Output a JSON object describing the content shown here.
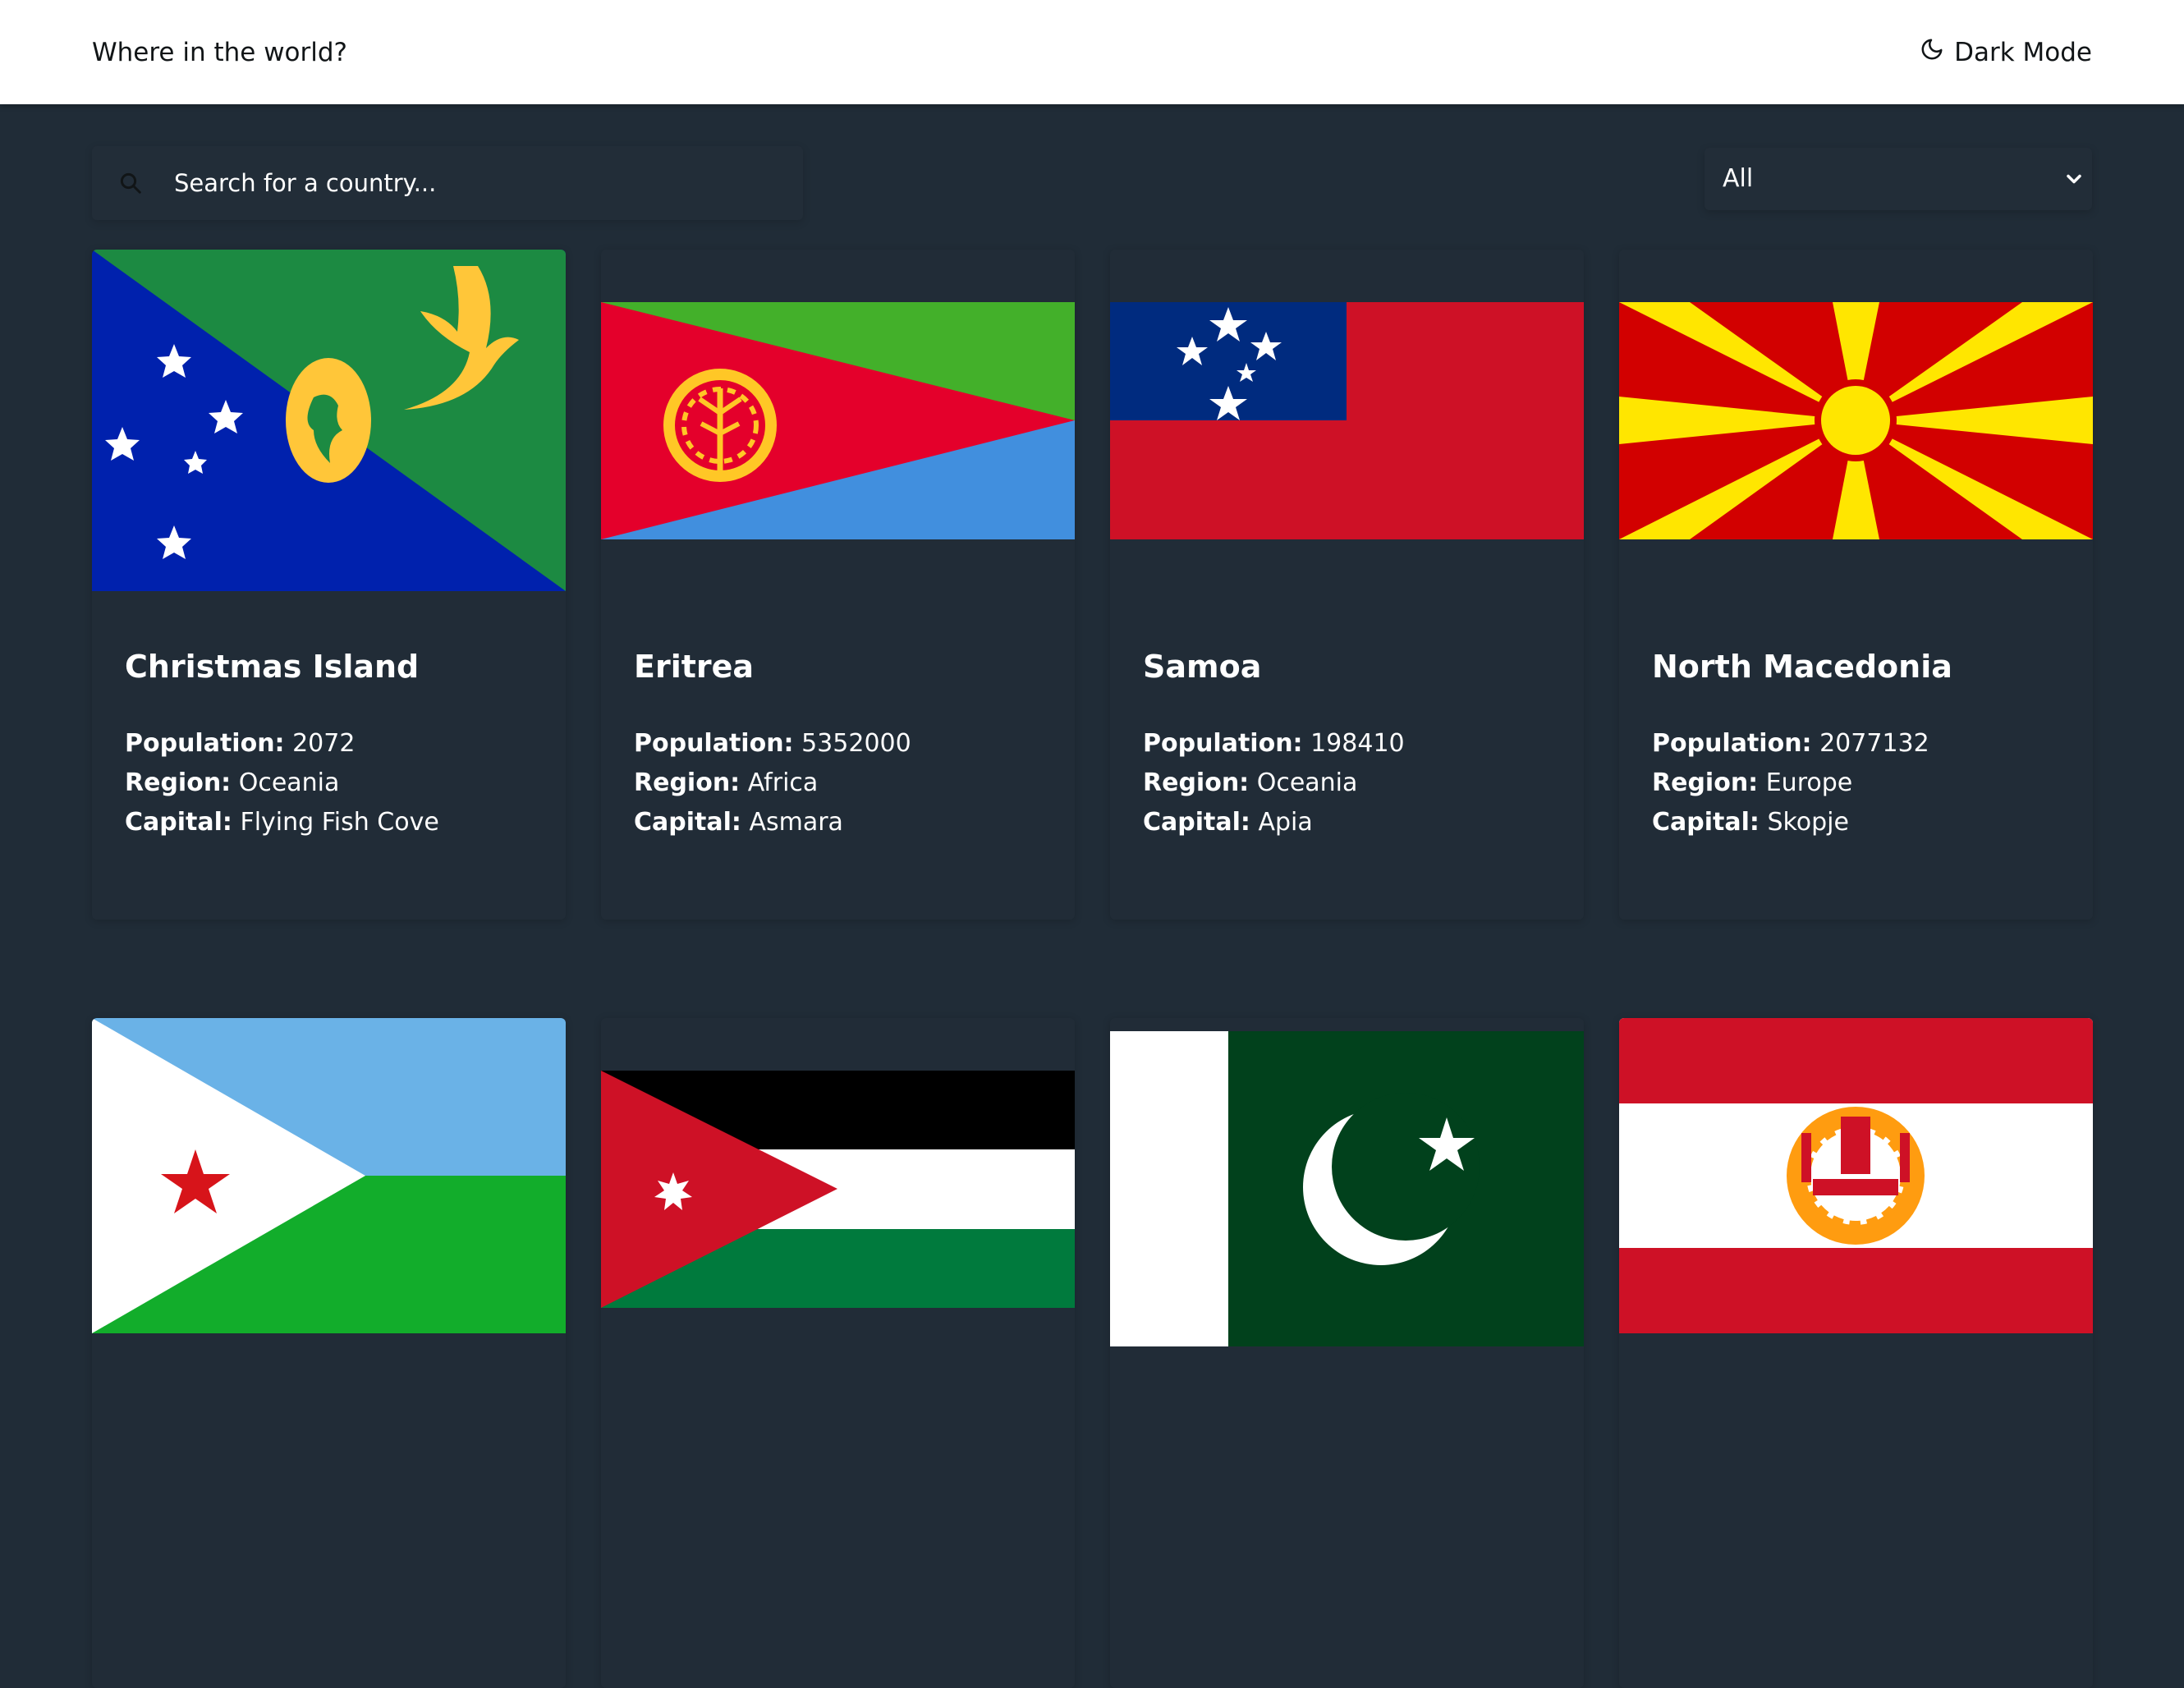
{
  "header": {
    "title": "Where in the world?",
    "mode_label": "Dark Mode"
  },
  "search": {
    "placeholder": "Search for a country..."
  },
  "filter": {
    "selected": "All"
  },
  "labels": {
    "population": "Population:",
    "region": "Region:",
    "capital": "Capital:"
  },
  "countries": [
    {
      "name": "Christmas Island",
      "population": "2072",
      "region": "Oceania",
      "capital": "Flying Fish Cove",
      "flag_icon": "christmas-island-flag"
    },
    {
      "name": "Eritrea",
      "population": "5352000",
      "region": "Africa",
      "capital": "Asmara",
      "flag_icon": "eritrea-flag"
    },
    {
      "name": "Samoa",
      "population": "198410",
      "region": "Oceania",
      "capital": "Apia",
      "flag_icon": "samoa-flag"
    },
    {
      "name": "North Macedonia",
      "population": "2077132",
      "region": "Europe",
      "capital": "Skopje",
      "flag_icon": "north-macedonia-flag"
    },
    {
      "flag_icon": "djibouti-flag"
    },
    {
      "flag_icon": "jordan-flag"
    },
    {
      "flag_icon": "pakistan-flag"
    },
    {
      "flag_icon": "french-polynesia-flag"
    }
  ],
  "colors": {
    "background": "#202c37",
    "card": "#212c37",
    "header": "#ffffff",
    "text_dark": "#111517",
    "text_light": "#ffffff"
  }
}
